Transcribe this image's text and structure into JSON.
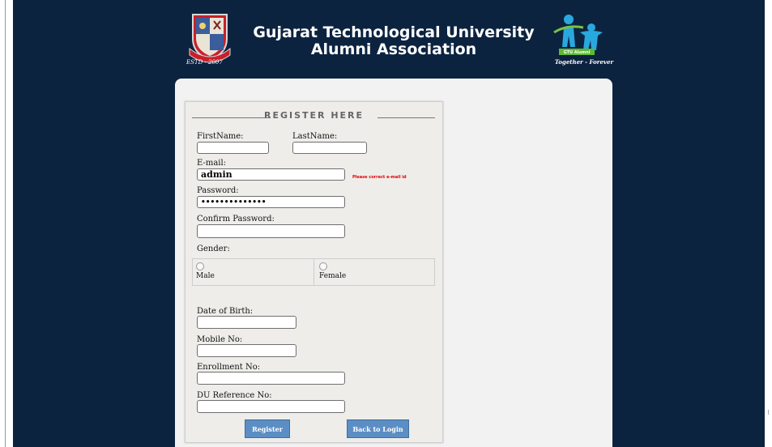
{
  "header": {
    "title_line1": "Gujarat Technological University",
    "title_line2": "Alumni Association",
    "left_logo_text": "ESTD - 2007",
    "right_logo_badge": "GTU Alumni",
    "right_logo_tagline": "Together - Forever"
  },
  "form": {
    "legend": "REGISTER HERE",
    "first_name_label": "FirstName:",
    "last_name_label": "LastName:",
    "email_label": "E-mail:",
    "email_value": "admin",
    "email_error": "Please correct e-mail id",
    "password_label": "Password:",
    "password_value": "••••••••••••••",
    "confirm_password_label": "Confirm Password:",
    "gender_label": "Gender:",
    "gender_options": [
      "Male",
      "Female"
    ],
    "dob_label": "Date of Birth:",
    "mobile_label": "Mobile No:",
    "enrollment_label": "Enrollment No:",
    "du_reference_label": "DU Reference No:",
    "register_button": "Register",
    "back_button": "Back to Login"
  },
  "colors": {
    "page_background": "#0c2340",
    "button": "#5b8ec4",
    "error": "#e00000"
  }
}
